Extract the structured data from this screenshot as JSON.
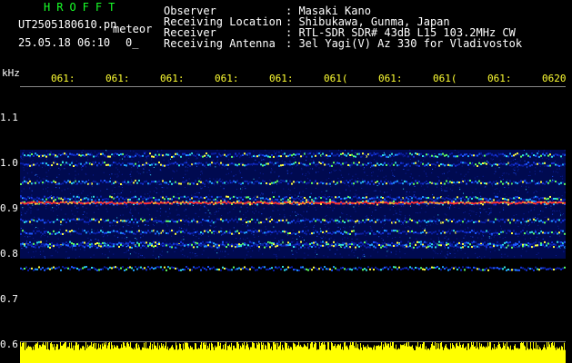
{
  "header": {
    "app_name": "HROFFT",
    "file_name": "UT2505180610.pn",
    "file_suffix": "meteor",
    "datetime": "25.05.18 06:10",
    "status": "0_",
    "rows": [
      {
        "label": "Observer",
        "value": ": Masaki Kano"
      },
      {
        "label": "Receiving Location",
        "value": ": Shibukawa, Gunma, Japan"
      },
      {
        "label": "Receiver",
        "value": ": RTL-SDR SDR# 43dB L15 103.2MHz CW"
      },
      {
        "label": "Receiving Antenna",
        "value": ": 3el Yagi(V) Az 330 for Vladivostok"
      }
    ]
  },
  "axis": {
    "y_unit": "kHz",
    "y_ticks": [
      "1.1",
      "1.0",
      "0.9",
      "0.8",
      "0.7",
      "0.6"
    ],
    "x_ticks": [
      "061:",
      "061:",
      "061:",
      "061:",
      "061:",
      "061(",
      "061:",
      "061(",
      "061:",
      "0620"
    ]
  },
  "colors": {
    "header_green": "#18ff28",
    "tick_yellow": "#ffff33",
    "background": "#000000",
    "noise_yellow": "#ffff00",
    "signal_red": "#ff3030"
  },
  "chart_data": {
    "type": "heatmap",
    "ylabel": "kHz",
    "ylim": [
      0.6,
      1.15
    ],
    "bands_khz": [
      1.02,
      1.0,
      0.96,
      0.925,
      0.915,
      0.875,
      0.85,
      0.825,
      0.82,
      0.77
    ],
    "strong_band_khz": 0.915
  }
}
